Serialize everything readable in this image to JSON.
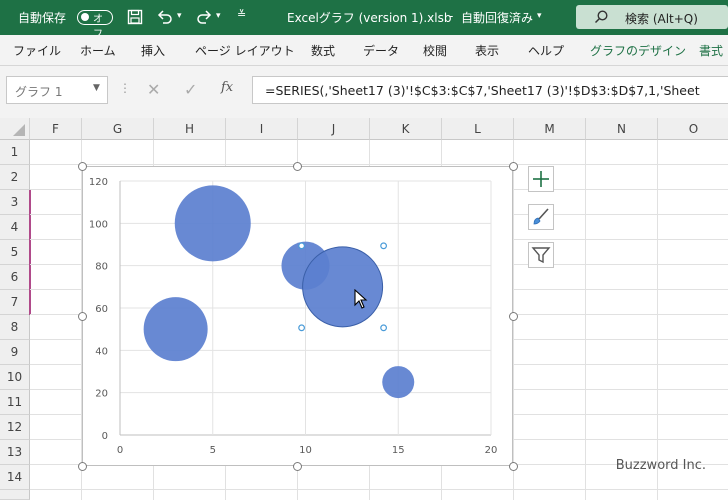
{
  "titlebar": {
    "autosave_label": "自動保存",
    "autosave_state": "オフ",
    "filename": "Excelグラフ (version 1).xlsb",
    "separator": "-",
    "save_status": "自動回復済み",
    "search_label": "検索 (Alt+Q)"
  },
  "ribbon": {
    "tabs": [
      "ファイル",
      "ホーム",
      "挿入",
      "ページ レイアウト",
      "数式",
      "データ",
      "校閲",
      "表示",
      "ヘルプ",
      "グラフのデザイン",
      "書式"
    ]
  },
  "formula_bar": {
    "name_box": "グラフ 1",
    "fx": "fx",
    "formula": "=SERIES(,'Sheet17 (3)'!$C$3:$C$7,'Sheet17 (3)'!$D$3:$D$7,1,'Sheet"
  },
  "grid": {
    "columns": [
      "F",
      "G",
      "H",
      "I",
      "J",
      "K",
      "L",
      "M",
      "N",
      "O"
    ],
    "rows": [
      "1",
      "2",
      "3",
      "4",
      "5",
      "6",
      "7",
      "8",
      "9",
      "10",
      "11",
      "12",
      "13",
      "14"
    ]
  },
  "chart_data": {
    "type": "bubble",
    "x_ticks": [
      "0",
      "5",
      "10",
      "15",
      "20"
    ],
    "y_ticks": [
      "0",
      "20",
      "40",
      "60",
      "80",
      "100",
      "120"
    ],
    "xlim": [
      0,
      20
    ],
    "ylim": [
      0,
      120
    ],
    "grid": true,
    "series": [
      {
        "points": [
          {
            "x": 3,
            "y": 50,
            "size": 32
          },
          {
            "x": 5,
            "y": 100,
            "size": 38
          },
          {
            "x": 10,
            "y": 80,
            "size": 24
          },
          {
            "x": 12,
            "y": 70,
            "size": 40
          },
          {
            "x": 15,
            "y": 25,
            "size": 16
          }
        ],
        "color": "#5b7fcf"
      }
    ],
    "selected_point_index": 3
  },
  "watermark": "Buzzword Inc.",
  "colors": {
    "excel_green": "#1e7145",
    "bubble": "#5b7fcf"
  }
}
